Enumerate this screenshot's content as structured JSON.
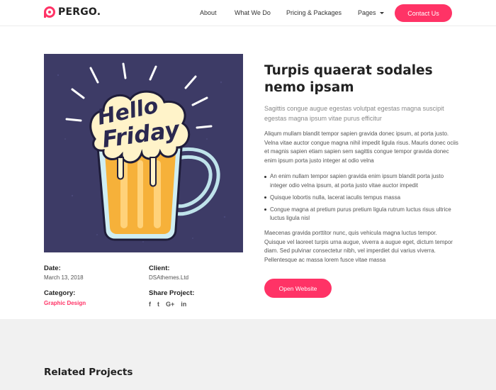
{
  "brand": {
    "name": "PERGO.",
    "accent": "#ff3366"
  },
  "nav": {
    "items": [
      "About",
      "What We Do",
      "Pricing & Packages",
      "Pages"
    ],
    "contact": "Contact Us"
  },
  "image": {
    "lettering": [
      "Hello",
      "Friday"
    ],
    "background": "#3d3b66",
    "icon": "beer-mug-illustration"
  },
  "project": {
    "title": "Turpis quaerat sodales nemo ipsam",
    "lead": "Sagittis congue augue egestas volutpat egestas magna suscipit egestas magna ipsum vitae purus efficitur",
    "paragraph1": "Aliqum mullam blandit tempor sapien gravida donec ipsum, at porta justo. Velna vitae auctor congue magna nihil impedit ligula risus. Mauris donec ociis et magnis sapien etiam sapien sem sagittis congue tempor gravida donec enim ipsum porta justo integer at odio velna",
    "bullets": [
      "An enim nullam tempor sapien gravida enim ipsum blandit porta justo integer odio velna ipsum, at porta justo vitae auctor impedit",
      "Quisque lobortis nulla, lacerat iaculis tempus massa",
      "Congue magna at pretium purus pretium ligula rutrum luctus risus ultrice luctus ligula nisl"
    ],
    "paragraph2": "Maecenas gravida porttitor nunc, quis vehicula magna luctus tempor. Quisque vel laoreet turpis urna augue, viverra a augue eget, dictum tempor diam. Sed pulvinar consectetur nibh, vel imperdiet dui varius viverra. Pellentesque ac massa lorem fusce vitae massa",
    "button": "Open Website"
  },
  "meta": {
    "date_label": "Date:",
    "date_value": "March 13, 2018",
    "client_label": "Client:",
    "client_value": "DSAthemes.Ltd",
    "category_label": "Category:",
    "category_value": "Graphic Design",
    "share_label": "Share Project:",
    "share_icons": [
      "f",
      "t",
      "G+",
      "in"
    ]
  },
  "related": {
    "title": "Related Projects"
  }
}
